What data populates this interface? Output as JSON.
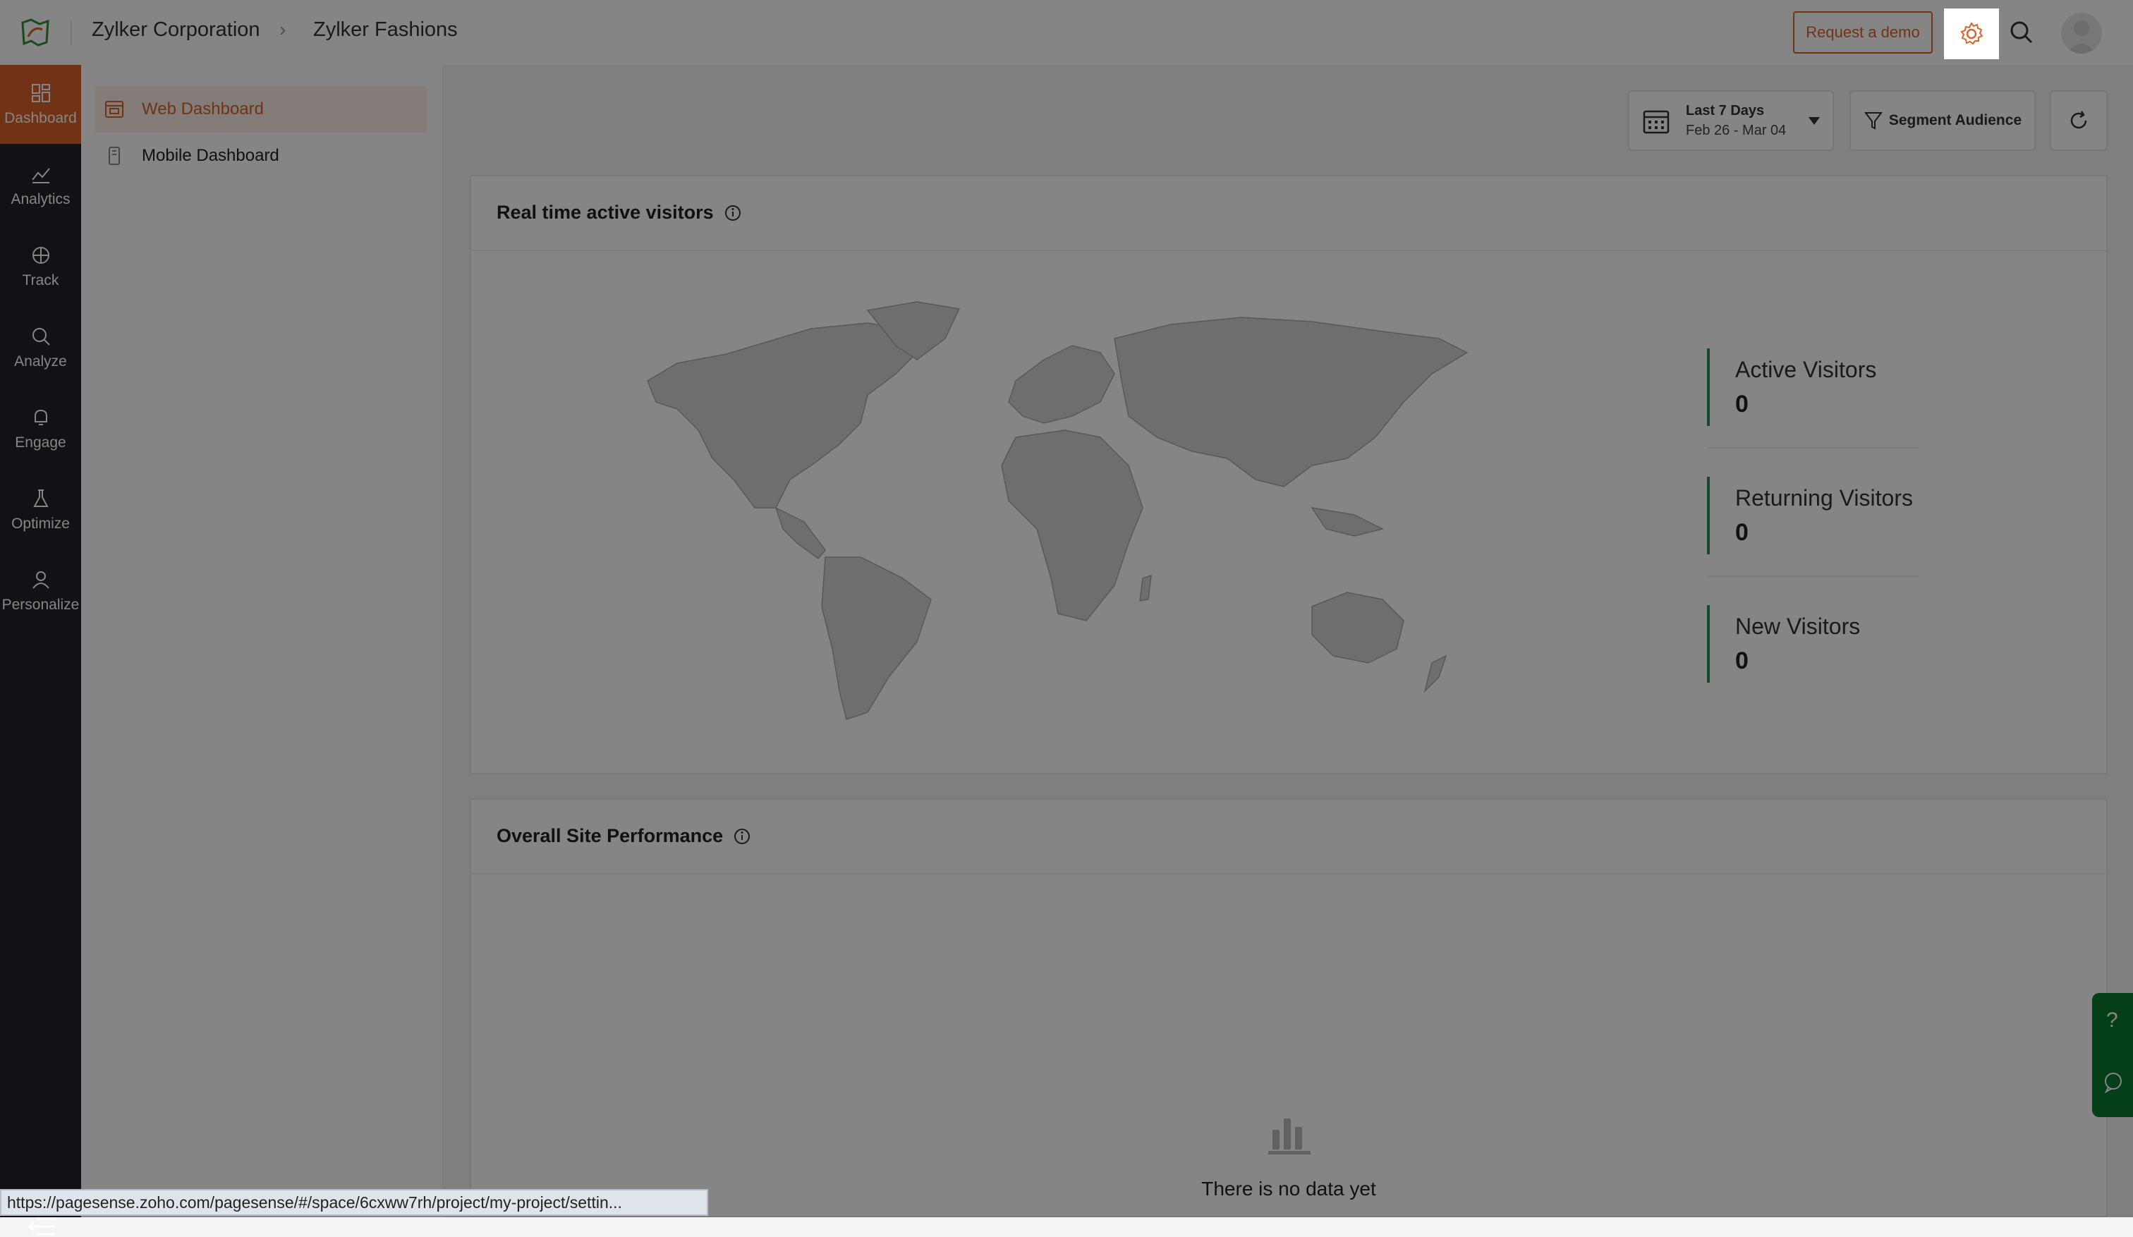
{
  "header": {
    "breadcrumb": [
      "Zylker Corporation",
      "Zylker Fashions"
    ],
    "request_demo_label": "Request a demo",
    "icons": [
      "logo-icon",
      "gear-icon",
      "search-icon",
      "avatar"
    ]
  },
  "leftnav": {
    "items": [
      {
        "label": "Dashboard",
        "icon": "dashboard-icon",
        "active": true
      },
      {
        "label": "Analytics",
        "icon": "analytics-icon"
      },
      {
        "label": "Track",
        "icon": "track-icon"
      },
      {
        "label": "Analyze",
        "icon": "analyze-icon"
      },
      {
        "label": "Engage",
        "icon": "bell-icon"
      },
      {
        "label": "Optimize",
        "icon": "flask-icon"
      },
      {
        "label": "Personalize",
        "icon": "user-icon"
      }
    ]
  },
  "submenu": {
    "items": [
      {
        "label": "Web Dashboard",
        "active": true
      },
      {
        "label": "Mobile Dashboard"
      }
    ]
  },
  "toolbar": {
    "date_range_title": "Last 7 Days",
    "date_range_value": "Feb 26 - Mar 04",
    "segment_label": "Segment Audience"
  },
  "realtime": {
    "title": "Real time active visitors",
    "stats": [
      {
        "label": "Active Visitors",
        "value": "0"
      },
      {
        "label": "Returning Visitors",
        "value": "0"
      },
      {
        "label": "New Visitors",
        "value": "0"
      }
    ]
  },
  "performance": {
    "title": "Overall Site Performance",
    "empty_text": "There is no data yet"
  },
  "status_url": "https://pagesense.zoho.com/pagesense/#/space/6cxww7rh/project/my-project/settin...",
  "help_tab": {
    "question_mark": "?"
  },
  "colors": {
    "accent": "#d9632a",
    "nav_bg": "#1f232b",
    "stat_bar": "#2e8b57",
    "help_bg": "#0b7a2f"
  }
}
